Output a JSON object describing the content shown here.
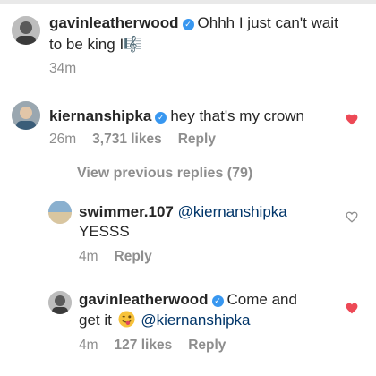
{
  "comments": [
    {
      "username": "gavinleatherwood",
      "text_part1": "Ohhh I just can't wait",
      "text_part2": "to be king I",
      "emoji_char": "🎼",
      "time": "34m"
    },
    {
      "username": "kiernanshipka",
      "text": "hey that's my crown",
      "time": "26m",
      "likes": "3,731 likes",
      "reply": "Reply",
      "liked": true
    }
  ],
  "view_previous": "View previous replies (79)",
  "replies": [
    {
      "username": "swimmer.107",
      "mention": "@kiernanshipka",
      "text": "YESSS",
      "time": "4m",
      "reply": "Reply",
      "liked": false
    },
    {
      "username": "gavinleatherwood",
      "text_part1": "Come and",
      "text_part2": "get it",
      "mention": "@kiernanshipka",
      "time": "4m",
      "likes": "127 likes",
      "reply": "Reply",
      "liked": true
    }
  ],
  "colors": {
    "like_red": "#ed4956",
    "verified_blue": "#3897f0",
    "muted": "#8e8e8e"
  },
  "icons": [
    "verified-badge-icon",
    "heart-icon",
    "music-note-icon",
    "winking-tongue-emoji"
  ]
}
